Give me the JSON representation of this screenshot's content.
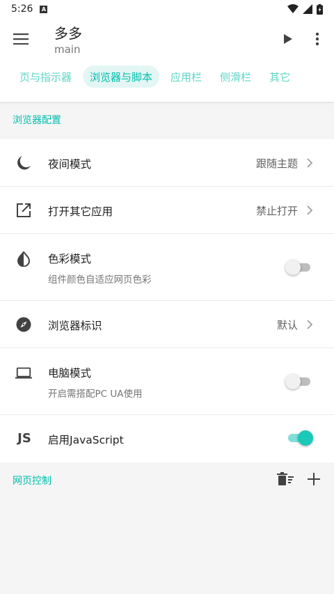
{
  "status": {
    "time": "5:26",
    "notif_letter": "A"
  },
  "app": {
    "title": "多多",
    "subtitle": "main",
    "tabs": [
      {
        "label": "页与指示器",
        "active": false
      },
      {
        "label": "浏览器与脚本",
        "active": true
      },
      {
        "label": "应用栏",
        "active": false
      },
      {
        "label": "侧滑栏",
        "active": false
      },
      {
        "label": "其它",
        "active": false
      }
    ]
  },
  "sections": {
    "browser_config": "浏览器配置",
    "web_control": "网页控制"
  },
  "rows": {
    "night_mode": {
      "label": "夜间模式",
      "value": "跟随主题",
      "icon": "moon-icon"
    },
    "open_other_app": {
      "label": "打开其它应用",
      "value": "禁止打开",
      "icon": "open-external-icon"
    },
    "color_mode": {
      "label": "色彩模式",
      "sub": "组件颜色自适应网页色彩",
      "icon": "contrast-icon",
      "enabled": false
    },
    "browser_ua": {
      "label": "浏览器标识",
      "value": "默认",
      "icon": "compass-icon"
    },
    "desktop_mode": {
      "label": "电脑模式",
      "sub": "开启需搭配PC UA使用",
      "icon": "laptop-icon",
      "enabled": false
    },
    "javascript": {
      "label": "启用JavaScript",
      "icon_text": "JS",
      "icon": "javascript-icon",
      "enabled": true
    }
  },
  "colors": {
    "accent": "#00bfae",
    "tab_inactive": "#5cd6c7"
  }
}
